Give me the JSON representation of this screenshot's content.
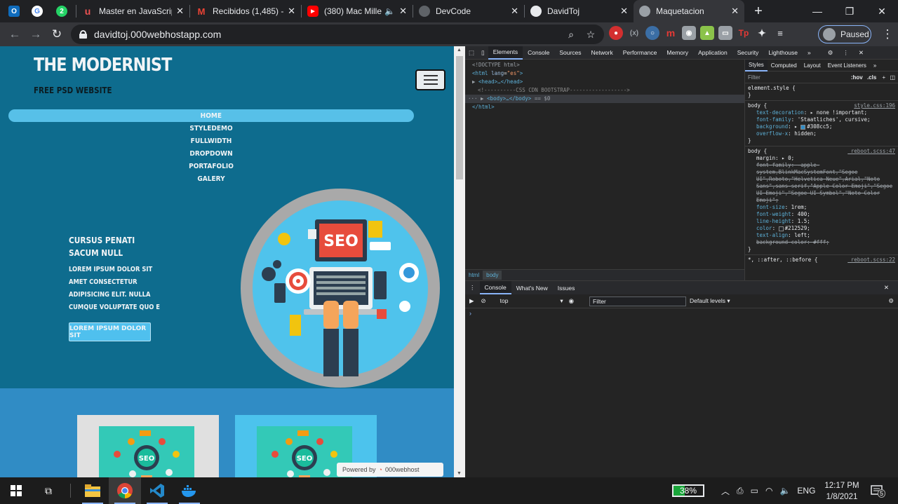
{
  "browser": {
    "tabs": [
      {
        "title": "Master en JavaScrip",
        "favicon": "udemy-icon",
        "color": "#ec5252",
        "active": false
      },
      {
        "title": "Recibidos (1,485) - c",
        "favicon": "gmail-icon",
        "color": "#ea4335",
        "active": false
      },
      {
        "title": "(380) Mac Mille",
        "favicon": "youtube-icon",
        "color": "#ff0000",
        "active": false
      },
      {
        "title": "DevCode",
        "favicon": "globe-icon",
        "color": "#9aa0a6",
        "active": false
      },
      {
        "title": "DavidToj",
        "favicon": "globe-icon",
        "color": "#e8eaed",
        "active": false
      },
      {
        "title": "Maquetacion",
        "favicon": "globe-icon",
        "color": "#9aa0a6",
        "active": true
      }
    ],
    "pinned": [
      {
        "name": "outlook-icon",
        "color": "#0f6cbd",
        "label": "O"
      },
      {
        "name": "google-icon",
        "color": "#ffffff",
        "label": "G"
      },
      {
        "name": "whatsapp-icon",
        "color": "#25d366",
        "label": "2"
      }
    ],
    "url": "davidtoj.000webhostapp.com",
    "profile_label": "Paused"
  },
  "page": {
    "brand": "THE MODERNIST",
    "brand_sub": "FREE PSD WEBSITE",
    "nav": [
      "HOME",
      "STYLEDEMO",
      "FULLWIDTH",
      "DROPDOWN",
      "PORTAFOLIO",
      "GALERY"
    ],
    "hero_title": "CURSUS PENATI SACUM NULL",
    "hero_body": "LOREM IPSUM DOLOR SIT AMET CONSECTETUR ADIPISICING ELIT. NULLA CUMQUE VOLUPTATE QUO E",
    "hero_button": "LOREM IPSUM DOLOR SIT",
    "seo_label": "SEO",
    "card_seo_label": "SEO",
    "powered_prefix": "Powered by",
    "powered_brand": "000webhost"
  },
  "devtools": {
    "tabs": [
      "Elements",
      "Console",
      "Sources",
      "Network",
      "Performance",
      "Memory",
      "Application",
      "Security",
      "Lighthouse"
    ],
    "dom": {
      "doctype": "<!DOCTYPE html>",
      "html_open": "html",
      "lang_attr": "lang",
      "lang_val": "\"es\"",
      "head": "<head>…</head>",
      "comment": "<!----------CSS CDN  BOOTSTRAP------------------>",
      "body": "<body>…</body>",
      "body_ref": "== $0",
      "html_close": "</html>"
    },
    "breadcrumb": [
      "html",
      "body"
    ],
    "styles_tabs": [
      "Styles",
      "Computed",
      "Layout",
      "Event Listeners"
    ],
    "filter_placeholder": "Filter",
    "hov": ":hov",
    "cls": ".cls",
    "element_style": "element.style {",
    "rule1": {
      "selector": "body {",
      "source": "style.css:196",
      "props": [
        {
          "name": "text-decoration",
          "value": "none !important;"
        },
        {
          "name": "font-family",
          "value": "'Staatliches', cursive;"
        },
        {
          "name": "background",
          "value": "#308cc5;",
          "swatch": "#308cc5"
        },
        {
          "name": "overflow-x",
          "value": "hidden;"
        }
      ]
    },
    "rule2": {
      "selector": "body {",
      "source": "_reboot.scss:47",
      "margin": "margin: ▸ 0;",
      "ff_struck": "font-family: -apple-system,BlinkMacSystemFont,\"Segoe UI\",Roboto,\"Helvetica Neue\",Arial,\"Noto Sans\",sans-serif,\"Apple Color Emoji\",\"Segoe UI Emoji\",\"Segoe UI Symbol\",\"Noto Color Emoji\";",
      "props": [
        {
          "name": "font-size",
          "value": "1rem;"
        },
        {
          "name": "font-weight",
          "value": "400;"
        },
        {
          "name": "line-height",
          "value": "1.5;"
        },
        {
          "name": "color",
          "value": "#212529;",
          "swatch": "#212529"
        },
        {
          "name": "text-align",
          "value": "left;"
        }
      ],
      "bg_struck": "background-color: #fff;"
    },
    "rule3": {
      "selector": "*, ::after, ::before {",
      "source": "_reboot.scss:22"
    },
    "console_tabs": [
      "Console",
      "What's New",
      "Issues"
    ],
    "context": "top",
    "console_filter": "Filter",
    "levels": "Default levels"
  },
  "taskbar": {
    "battery": "38%",
    "battery_level": 0.38,
    "lang": "ENG",
    "time": "12:17 PM",
    "date": "1/8/2021",
    "notifications": "5"
  }
}
